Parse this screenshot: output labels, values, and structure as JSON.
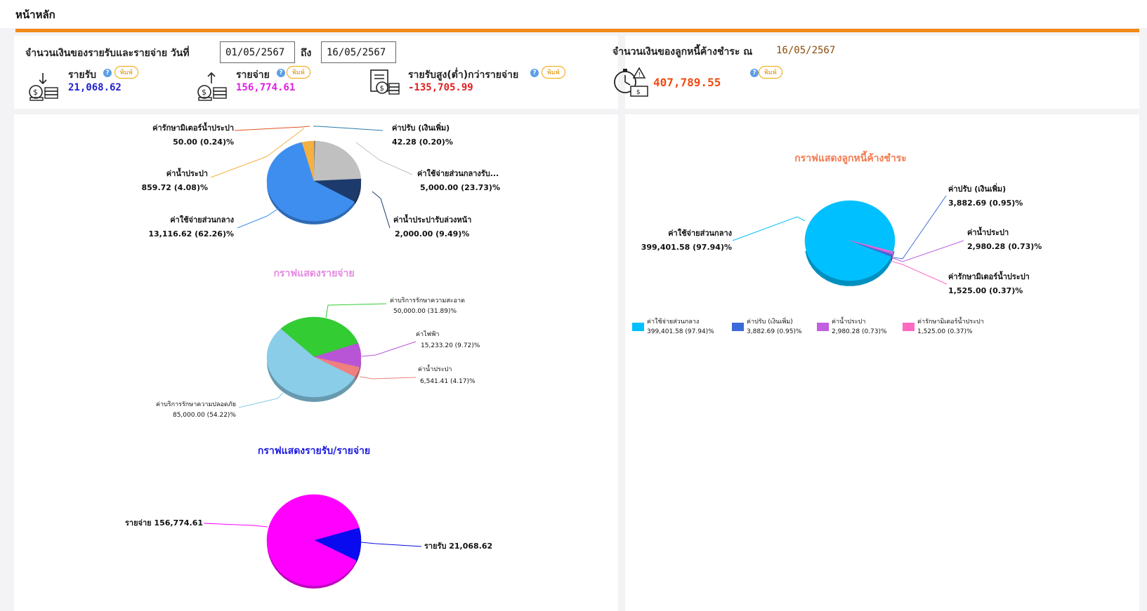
{
  "page": {
    "title": "หน้าหลัก"
  },
  "summary": {
    "header": "จำนวนเงินของรายรับและรายจ่าย วันที่",
    "date_from": "01/05/2567",
    "to_label": "ถึง",
    "date_to": "16/05/2567",
    "print_label": "พิมพ์",
    "income": {
      "label": "รายรับ",
      "value": "21,068.62",
      "color": "#2020d0"
    },
    "expense": {
      "label": "รายจ่าย",
      "value": "156,774.61",
      "color": "#e020e0"
    },
    "diff": {
      "label": "รายรับสูง(ต่ำ)กว่ารายจ่าย",
      "value": "-135,705.99",
      "color": "#e02020"
    }
  },
  "debt": {
    "header": "จำนวนเงินของลูกหนี้ค้างชำระ ณ",
    "date": "16/05/2567",
    "value": "407,789.55",
    "value_color": "#f24a10",
    "print_label": "พิมพ์"
  },
  "chart_data": [
    {
      "type": "pie",
      "title": "",
      "series": [
        {
          "name": "ค่ารักษามิเตอร์น้ำประปา",
          "value": 50.0,
          "label": "50.00 (0.24)%",
          "color": "#e0521e"
        },
        {
          "name": "ค่าปรับ (เงินเพิ่ม)",
          "value": 42.28,
          "label": "42.28 (0.20)%",
          "color": "#2a7ba5"
        },
        {
          "name": "ค่าใช้จ่ายส่วนกลางรับ...",
          "value": 5000.0,
          "label": "5,000.00 (23.73)%",
          "color": "#c0c0c0"
        },
        {
          "name": "ค่าน้ำประปารับล่วงหน้า",
          "value": 2000.0,
          "label": "2,000.00 (9.49)%",
          "color": "#1c3a6b"
        },
        {
          "name": "ค่าใช้จ่ายส่วนกลาง",
          "value": 13116.62,
          "label": "13,116.62 (62.26)%",
          "color": "#3e8ef0"
        },
        {
          "name": "ค่าน้ำประปา",
          "value": 859.72,
          "label": "859.72 (4.08)%",
          "color": "#f5b042"
        }
      ]
    },
    {
      "type": "pie",
      "title": "กราฟแสดงรายจ่าย",
      "title_color": "#e48ae0",
      "series": [
        {
          "name": "ค่าบริการรักษาความสะอาด",
          "value": 50000.0,
          "label": "50,000.00 (31.89)%",
          "color": "#33cc33"
        },
        {
          "name": "ค่าไฟฟ้า",
          "value": 15233.2,
          "label": "15,233.20 (9.72)%",
          "color": "#b855d6"
        },
        {
          "name": "ค่าน้ำประปา",
          "value": 6541.41,
          "label": "6,541.41 (4.17)%",
          "color": "#f07f7f"
        },
        {
          "name": "ค่าบริการรักษาความปลอดภัย",
          "value": 85000.0,
          "label": "85,000.00 (54.22)%",
          "color": "#8acde9"
        }
      ]
    },
    {
      "type": "pie",
      "title": "กราฟแสดงรายรับ/รายจ่าย",
      "title_color": "#1a1ae0",
      "series": [
        {
          "name": "รายรับ",
          "value": 21068.62,
          "label": "รายรับ 21,068.62",
          "color": "#0a0af0"
        },
        {
          "name": "รายจ่าย",
          "value": 156774.61,
          "label": "รายจ่าย 156,774.61",
          "color": "#ff00ff"
        }
      ]
    },
    {
      "type": "pie",
      "title": "กราฟแสดงลูกหนี้ค้างชำระ",
      "title_color": "#f47a50",
      "legend": "bottom",
      "series": [
        {
          "name": "ค่าใช้จ่ายส่วนกลาง",
          "value": 399401.58,
          "label": "399,401.58 (97.94)%",
          "color": "#00c0ff"
        },
        {
          "name": "ค่าปรับ (เงินเพิ่ม)",
          "value": 3882.69,
          "label": "3,882.69 (0.95)%",
          "color": "#3c6ad8"
        },
        {
          "name": "ค่าน้ำประปา",
          "value": 2980.28,
          "label": "2,980.28 (0.73)%",
          "color": "#c060e0"
        },
        {
          "name": "ค่ารักษามิเตอร์น้ำประปา",
          "value": 1525.0,
          "label": "1,525.00 (0.37)%",
          "color": "#ff6ac0"
        }
      ]
    }
  ]
}
